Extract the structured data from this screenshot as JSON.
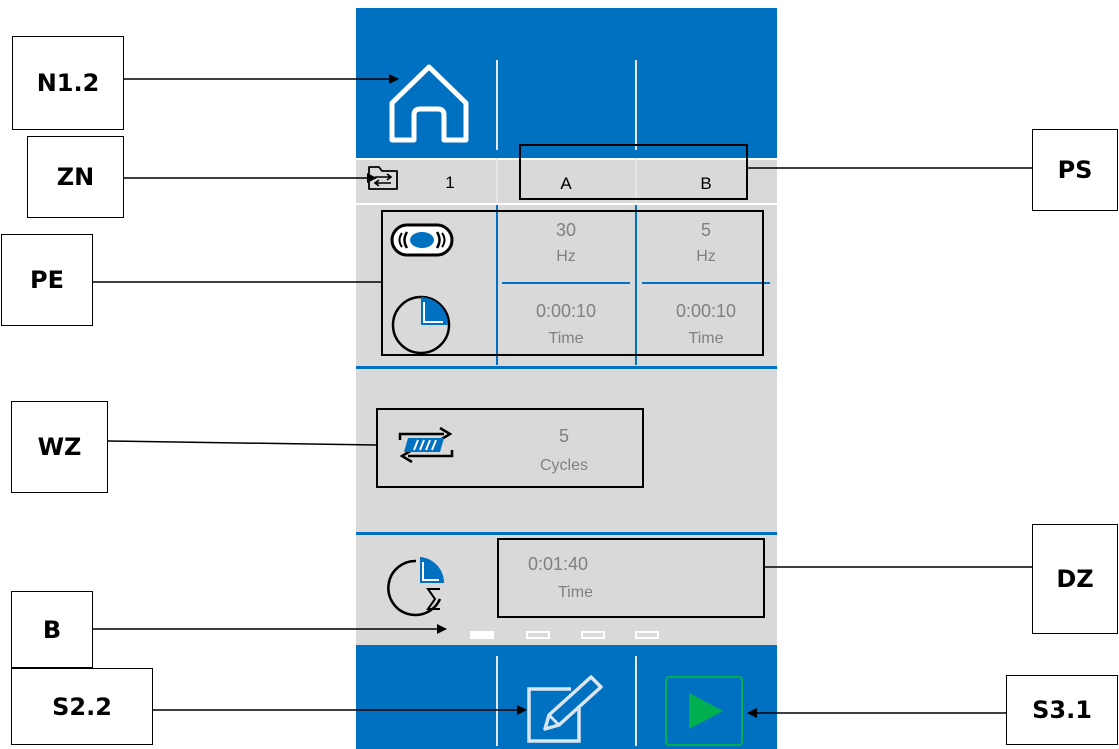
{
  "labels": {
    "n12": "N1.2",
    "zn": "ZN",
    "pe": "PE",
    "wz": "WZ",
    "b": "B",
    "s22": "S2.2",
    "ps": "PS",
    "dz": "DZ",
    "s31": "S3.1"
  },
  "screen": {
    "program_number": "1",
    "column_a": "A",
    "column_b": "B",
    "freq_a_value": "30",
    "freq_a_unit": "Hz",
    "freq_b_value": "5",
    "freq_b_unit": "Hz",
    "time_a_value": "0:00:10",
    "time_a_unit": "Time",
    "time_b_value": "0:00:10",
    "time_b_unit": "Time",
    "cycles_value": "5",
    "cycles_unit": "Cycles",
    "total_time_value": "0:01:40",
    "total_time_unit": "Time",
    "page_indicator": {
      "pages": 4,
      "active": 1
    }
  },
  "colors": {
    "brand_blue": "#0070c0",
    "panel_gray": "#d9d9d9",
    "play_green": "#00b050"
  },
  "icons": [
    "home-icon",
    "program-folder-icon",
    "vibration-icon",
    "timer-icon",
    "repeat-cycles-icon",
    "total-time-icon",
    "edit-icon",
    "play-icon"
  ]
}
